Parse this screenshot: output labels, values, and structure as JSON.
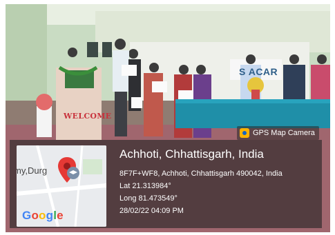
{
  "scene": {
    "banner_text": "WELCOME",
    "backdrop_text": "S  ACAR"
  },
  "badge": {
    "label": "GPS Map Camera",
    "icon": "gps-map-camera-app-icon"
  },
  "map": {
    "place_label": "my,Durg",
    "brand": [
      "G",
      "o",
      "o",
      "g",
      "l",
      "e"
    ],
    "brand_colors": [
      "#4285F4",
      "#EA4335",
      "#FBBC05",
      "#4285F4",
      "#34A853",
      "#EA4335"
    ],
    "pin_color": "#e53935"
  },
  "location": {
    "title": "Achhoti, Chhattisgarh, India",
    "address": "8F7F+WF8, Achhoti, Chhattisgarh 490042, India",
    "lat": "Lat 21.313984°",
    "long": "Long 81.473549°",
    "datetime": "28/02/22 04:09 PM"
  }
}
